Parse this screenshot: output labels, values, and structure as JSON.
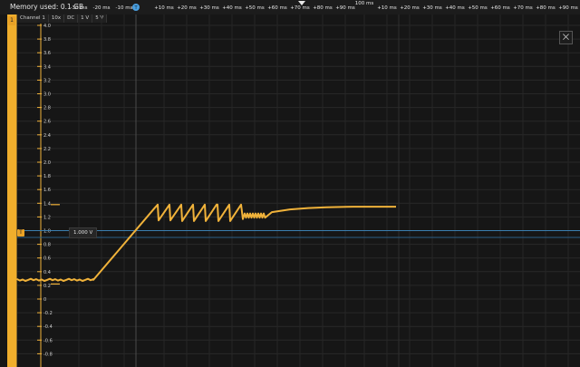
{
  "status": {
    "memory": "Memory used: 0.1 GB"
  },
  "channel_bar": {
    "channel": "Channel 1",
    "probe": "10x",
    "coupling": "DC",
    "scale": "1 V",
    "offset": "5 V"
  },
  "channel_tab": "1",
  "trigger": {
    "marker": "T",
    "level_label": "1.000 V",
    "level": 1.0
  },
  "time_axis": {
    "ticks": [
      "-30 ms",
      "-20 ms",
      "-10 ms",
      "+10 ms",
      "+20 ms",
      "+30 ms",
      "+40 ms",
      "+50 ms",
      "+60 ms",
      "+70 ms",
      "+80 ms",
      "+90 ms",
      "100 ms",
      "+10 ms",
      "+20 ms",
      "+30 ms",
      "+40 ms",
      "+50 ms",
      "+60 ms",
      "+70 ms",
      "+80 ms",
      "+90 ms"
    ],
    "origin_marker": "T"
  },
  "volt_axis": {
    "ticks": [
      "4.0",
      "3.8",
      "3.6",
      "3.4",
      "3.2",
      "3.0",
      "2.8",
      "2.6",
      "2.4",
      "2.2",
      "2.0",
      "1.8",
      "1.6",
      "1.4",
      "1.2",
      "1.0",
      "0.8",
      "0.6",
      "0.4",
      "0.2",
      "0",
      "-0.2",
      "-0.4",
      "-0.6",
      "-0.8"
    ]
  },
  "icons": {
    "zoom": "zoom-fit-icon"
  },
  "colors": {
    "trace": "#f0b23a",
    "trigger_line": "#3b7fb0",
    "grid": "#2e2e2e",
    "background": "#161616"
  }
}
